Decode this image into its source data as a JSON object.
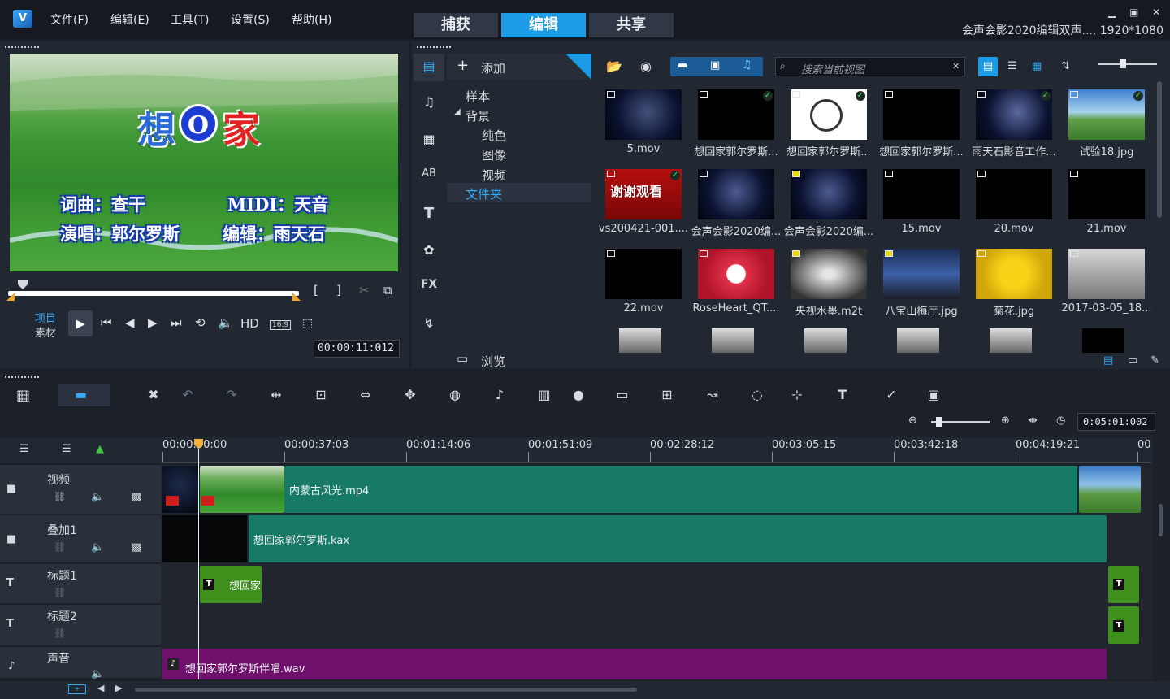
{
  "menu": {
    "file": "文件(F)",
    "edit": "编辑(E)",
    "tools": "工具(T)",
    "settings": "设置(S)",
    "help": "帮助(H)"
  },
  "tabs": {
    "capture": "捕获",
    "edit": "编辑",
    "share": "共享"
  },
  "window": {
    "title": "会声会影2020编辑双声..., 1920*1080",
    "min": "▁",
    "restore": "▣",
    "close": "✕"
  },
  "preview": {
    "big_title_1": "想",
    "big_title_2": "O",
    "big_title_3": "家",
    "line1_left": "词曲：查干",
    "line1_right": "MIDI：天音",
    "line2_left": "演唱：郭尔罗斯",
    "line2_right": "编辑：雨天石",
    "mode_project": "项目",
    "mode_clip": "素材",
    "hd": "HD",
    "aspect": "16:9",
    "timecode": "00:00:11:012"
  },
  "library": {
    "add_label": "添加",
    "tree": [
      "样本",
      "背景",
      "纯色",
      "图像",
      "视频",
      "文件夹"
    ],
    "search_placeholder": "搜索当前视图",
    "browse_label": "浏览",
    "items": [
      "5.mov",
      "想回家郭尔罗斯...",
      "想回家郭尔罗斯...",
      "想回家郭尔罗斯...",
      "雨天石影音工作...",
      "试验18.jpg",
      "vs200421-001....",
      "会声会影2020编...",
      "会声会影2020编...",
      "15.mov",
      "20.mov",
      "21.mov",
      "22.mov",
      "RoseHeart_QT....",
      "央视水墨.m2t",
      "八宝山梅厅.jpg",
      "菊花.jpg",
      "2017-03-05_18..."
    ],
    "thank_you_text": "谢谢观看"
  },
  "timeline": {
    "zoom_timecode": "0:05:01:002",
    "ruler": [
      "00:00:00:00",
      "00:00:37:03",
      "00:01:14:06",
      "00:01:51:09",
      "00:02:28:12",
      "00:03:05:15",
      "00:03:42:18",
      "00:04:19:21",
      "00"
    ],
    "tracks": [
      "视频",
      "叠加1",
      "标题1",
      "标题2",
      "声音"
    ],
    "clips": {
      "video": "内蒙古风光.mp4",
      "overlay": "想回家郭尔罗斯.kax",
      "title": "想回家",
      "audio": "想回家郭尔罗斯伴唱.wav"
    }
  },
  "colors": {
    "accent": "#1c9be6",
    "video_clip": "#167a66",
    "title_clip": "#3f8f1c",
    "audio_clip": "#6e106c"
  }
}
